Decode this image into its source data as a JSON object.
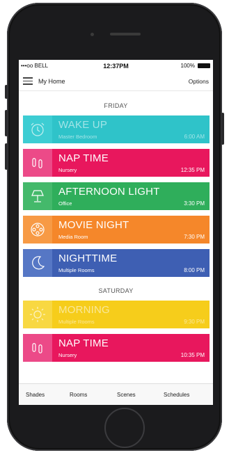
{
  "status": {
    "carrier": "•••oo BELL",
    "time": "12:37PM",
    "battery": "100%"
  },
  "nav": {
    "title": "My Home",
    "options": "Options"
  },
  "days": [
    "FRIDAY",
    "SATURDAY"
  ],
  "friday": [
    {
      "name": "WAKE UP",
      "room": "Master Bedroom",
      "time": "6:00 AM",
      "color": "#2fc3c9",
      "icon_color": "#3dcdd3",
      "icon": "alarm-clock-icon"
    },
    {
      "name": "NAP TIME",
      "room": "Nursery",
      "time": "12:35 PM",
      "color": "#e8175d",
      "icon_color": "#ec4a88",
      "icon": "baby-feet-icon"
    },
    {
      "name": "AFTERNOON LIGHT",
      "room": "Office",
      "time": "3:30 PM",
      "color": "#2fae5b",
      "icon_color": "#44b96b",
      "icon": "desk-lamp-icon"
    },
    {
      "name": "MOVIE NIGHT",
      "room": "Media Room",
      "time": "7:30 PM",
      "color": "#f5872a",
      "icon_color": "#f79a45",
      "icon": "film-reel-icon"
    },
    {
      "name": "NIGHTTIME",
      "room": "Multiple Rooms",
      "time": "8:00 PM",
      "color": "#3e5fb3",
      "icon_color": "#5677c5",
      "icon": "moon-icon"
    }
  ],
  "saturday": [
    {
      "name": "MORNING",
      "room": "Multiple Rooms",
      "time": "9:30 PM",
      "color": "#f6cd1b",
      "icon_color": "#f8d842",
      "icon": "sun-icon"
    },
    {
      "name": "NAP TIME",
      "room": "Nursery",
      "time": "10:35 PM",
      "color": "#e8175d",
      "icon_color": "#ec4a88",
      "icon": "baby-feet-icon"
    }
  ],
  "tabs": [
    "Shades",
    "Rooms",
    "Scenes",
    "Schedules"
  ]
}
